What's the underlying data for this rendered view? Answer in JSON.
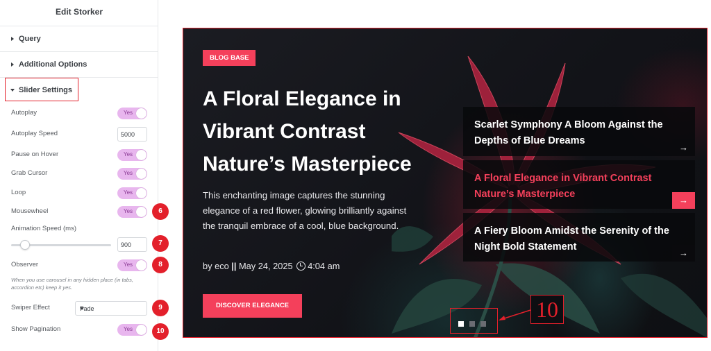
{
  "panel": {
    "title": "Edit Storker",
    "sections": [
      {
        "label": "Query"
      },
      {
        "label": "Additional Options"
      },
      {
        "label": "Slider Settings"
      }
    ],
    "settings": {
      "autoplay": {
        "label": "Autoplay",
        "value": "Yes"
      },
      "autoplay_speed": {
        "label": "Autoplay Speed",
        "value": "5000"
      },
      "pause_on_hover": {
        "label": "Pause on Hover",
        "value": "Yes"
      },
      "grab_cursor": {
        "label": "Grab Cursor",
        "value": "Yes"
      },
      "loop": {
        "label": "Loop",
        "value": "Yes"
      },
      "mousewheel": {
        "label": "Mousewheel",
        "value": "Yes"
      },
      "animation_speed": {
        "label": "Animation Speed (ms)",
        "value": "900",
        "slider_fraction": 0.14
      },
      "observer": {
        "label": "Observer",
        "value": "Yes",
        "hint": "When you use carousel in any hidden place (in tabs, accordion etc) keep it yes."
      },
      "swiper_effect": {
        "label": "Swiper Effect",
        "value": "Fade"
      },
      "show_pagination": {
        "label": "Show Pagination",
        "value": "Yes"
      }
    },
    "badges": [
      "6",
      "7",
      "8",
      "9",
      "10"
    ]
  },
  "preview": {
    "tag": "BLOG BASE",
    "title": "A Floral Elegance in Vibrant Contrast Nature’s Masterpiece",
    "description": "This enchanting image captures the stunning elegance of a red flower, glowing brilliantly against the tranquil embrace of a cool, blue background.",
    "meta_author": "by eco",
    "meta_sep": "||",
    "meta_date": "May 24, 2025",
    "meta_time": "4:04 am",
    "cta": "DISCOVER ELEGANCE",
    "cards": [
      {
        "title": "Scarlet Symphony A Bloom Against the Depths of Blue Dreams",
        "arrow": "→"
      },
      {
        "title": "A Floral Elegance in Vibrant Contrast Nature’s Masterpiece",
        "arrow": "→"
      },
      {
        "title": "A Fiery Bloom Amidst the Serenity of the Night Bold Statement",
        "arrow": "→"
      }
    ],
    "pagination_callout": "10"
  },
  "colors": {
    "accent": "#f4405b",
    "annotation_red": "#e3202b",
    "toggle_bg": "#e8b6ee"
  }
}
